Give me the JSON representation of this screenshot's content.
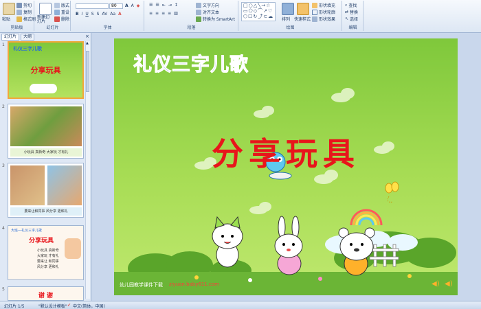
{
  "ribbon": {
    "clipboard": {
      "label": "剪贴板",
      "paste": "粘贴",
      "cut": "剪切",
      "copy": "复制",
      "format_painter": "格式刷"
    },
    "slides": {
      "label": "幻灯片",
      "new_slide": "新建幻灯片",
      "layout": "版式",
      "reset": "重设",
      "delete": "删除"
    },
    "font": {
      "label": "字体",
      "size": "80"
    },
    "paragraph": {
      "label": "段落",
      "text_direction": "文字方向",
      "align_text": "对齐文本",
      "smartart": "转换为 SmartArt"
    },
    "drawing": {
      "label": "绘图",
      "arrange": "排列",
      "quick_styles": "快速样式",
      "shape_fill": "形状填充",
      "shape_outline": "形状轮廓",
      "shape_effects": "形状效果"
    },
    "editing": {
      "label": "编辑",
      "find": "查找",
      "replace": "替换",
      "select": "选择"
    }
  },
  "panel": {
    "tabs": [
      "幻灯片",
      "大纲"
    ],
    "slide_numbers": [
      "1",
      "2",
      "3",
      "4",
      "5"
    ],
    "thumb1": {
      "title": "礼仪三字儿歌",
      "subtitle": "分享玩具"
    },
    "thumb2": {
      "caption": "小玩具 真新奇 大家玩 才有礼"
    },
    "thumb3": {
      "caption": "要来让和同事 风分享 更和礼"
    },
    "thumb4": {
      "header": "大班—礼仪三字儿歌",
      "title": "分享玩具",
      "lines": [
        "小玩具 真新奇",
        "大家玩 才有礼",
        "要来让 和同事",
        "风分享 更和礼"
      ]
    },
    "thumb5": {
      "title": "谢  谢"
    }
  },
  "slide": {
    "title": "礼仪三字儿歌",
    "subtitle": "分享玩具",
    "footer_cn": "幼儿园教学课件下载",
    "footer_url": "ziyuan.baby611.com"
  },
  "status": {
    "slide_count": "幻灯片 1/5",
    "theme": "\"默认设计模板\"",
    "language": "中文(简体，中国)"
  },
  "colors": {
    "accent": "#f2a73a",
    "slide_green": "#8fd147",
    "title_red": "#e8151b"
  }
}
